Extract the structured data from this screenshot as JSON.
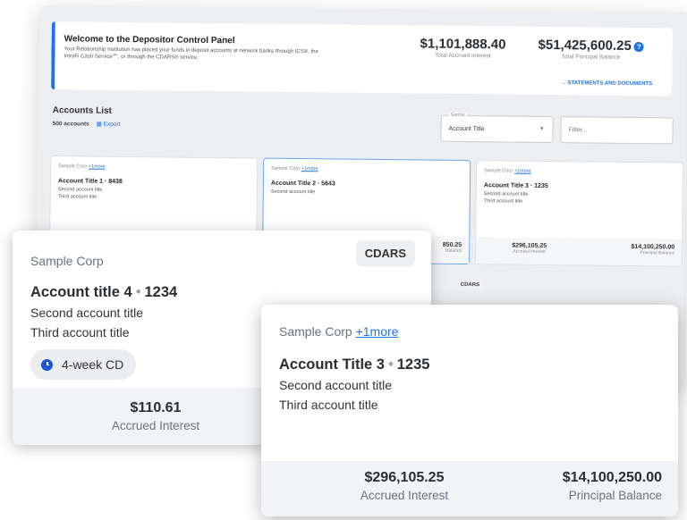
{
  "welcome": {
    "title": "Welcome to the Depositor Control Panel",
    "body": "Your Relationship Institution has placed your funds in deposit accounts at network banks through ICS®, the IntraFi Cash Service℠, or through the CDARS® service.",
    "accrued_value": "$1,101,888.40",
    "accrued_label": "Total Accrued Interest",
    "principal_value": "$51,425,600.25",
    "principal_label": "Total Principal Balance",
    "statements_link": "→ STATEMENTS AND DOCUMENTS"
  },
  "accounts": {
    "title": "Accounts List",
    "count": "500 accounts",
    "export_label": "Export",
    "sort_label": "Sort by",
    "sort_value": "Account Title",
    "filter_placeholder": "Filter..."
  },
  "mini_cards": [
    {
      "corp": "Sample Corp",
      "more": "+1more",
      "title": "Account Title 1 · 8438",
      "sub1": "Second account title",
      "sub2": "Third account title",
      "accrued": "",
      "principal": ""
    },
    {
      "corp": "Sample Corp",
      "more": "+1more",
      "title": "Account Title 2 · 5643",
      "sub1": "Second account title",
      "sub2": "",
      "accrued": "",
      "principal": "850.25",
      "principal_label": "Balance"
    },
    {
      "corp": "Sample Corp",
      "more": "+1more",
      "title": "Account Title 3 · 1235",
      "sub1": "Second account title",
      "sub2": "Third account title",
      "accrued": "$296,105.25",
      "accrued_label": "Accrued Interest",
      "principal": "$14,100,250.00",
      "principal_label": "Principal Balance"
    }
  ],
  "mini_badge": "CDARS",
  "card4": {
    "corp": "Sample Corp",
    "badge": "CDARS",
    "title_main": "Account title 4",
    "title_dot": "•",
    "title_num": "1234",
    "sub1": "Second account title",
    "sub2": "Third account title",
    "chip": "4-week CD",
    "accrued": "$110.61",
    "accrued_label": "Accrued Interest"
  },
  "card3": {
    "corp": "Sample Corp",
    "more": "+1more",
    "title_main": "Account Title 3",
    "title_dot": "•",
    "title_num": "1235",
    "sub1": "Second account title",
    "sub2": "Third account title",
    "accrued": "$296,105.25",
    "accrued_label": "Accrued Interest",
    "principal": "$14,100,250.00",
    "principal_label": "Principal Balance"
  },
  "colors": {
    "accent": "#1a73e8",
    "clock": "#1a57d6"
  }
}
